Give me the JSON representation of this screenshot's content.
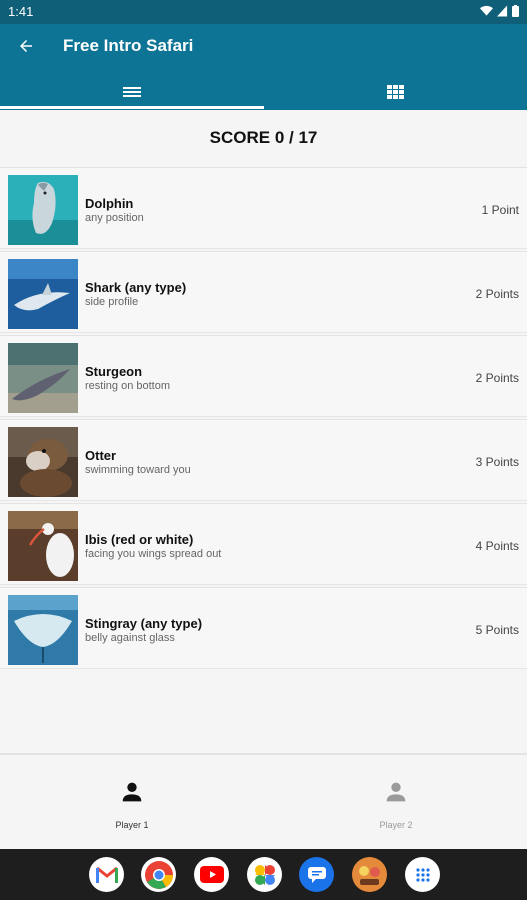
{
  "status": {
    "time": "1:41"
  },
  "app_bar": {
    "title": "Free Intro Safari",
    "tabs": [
      {
        "icon": "list-icon",
        "active": true
      },
      {
        "icon": "grid-icon",
        "active": false
      }
    ]
  },
  "score": {
    "text": "SCORE 0 / 17"
  },
  "items": [
    {
      "title": "Dolphin",
      "subtitle": "any position",
      "points": "1 Point",
      "image": "dolphin-photo"
    },
    {
      "title": "Shark (any type)",
      "subtitle": "side profile",
      "points": "2 Points",
      "image": "shark-photo"
    },
    {
      "title": "Sturgeon",
      "subtitle": "resting on bottom",
      "points": "2 Points",
      "image": "sturgeon-photo"
    },
    {
      "title": "Otter",
      "subtitle": "swimming toward you",
      "points": "3 Points",
      "image": "otter-photo"
    },
    {
      "title": "Ibis (red or white)",
      "subtitle": "facing you wings spread out",
      "points": "4 Points",
      "image": "ibis-photo"
    },
    {
      "title": "Stingray (any type)",
      "subtitle": "belly against glass",
      "points": "5 Points",
      "image": "stingray-photo"
    }
  ],
  "players": [
    {
      "label": "Player 1",
      "active": true
    },
    {
      "label": "Player 2",
      "active": false
    }
  ],
  "dock": [
    "gmail-icon",
    "chrome-icon",
    "youtube-icon",
    "photos-icon",
    "messages-icon",
    "game-app-icon",
    "app-drawer-icon"
  ],
  "colors": {
    "status_bar": "#0e5f77",
    "app_bar": "#0e7495",
    "background": "#f5f5f5",
    "nav_bar": "#1e1e1e"
  }
}
